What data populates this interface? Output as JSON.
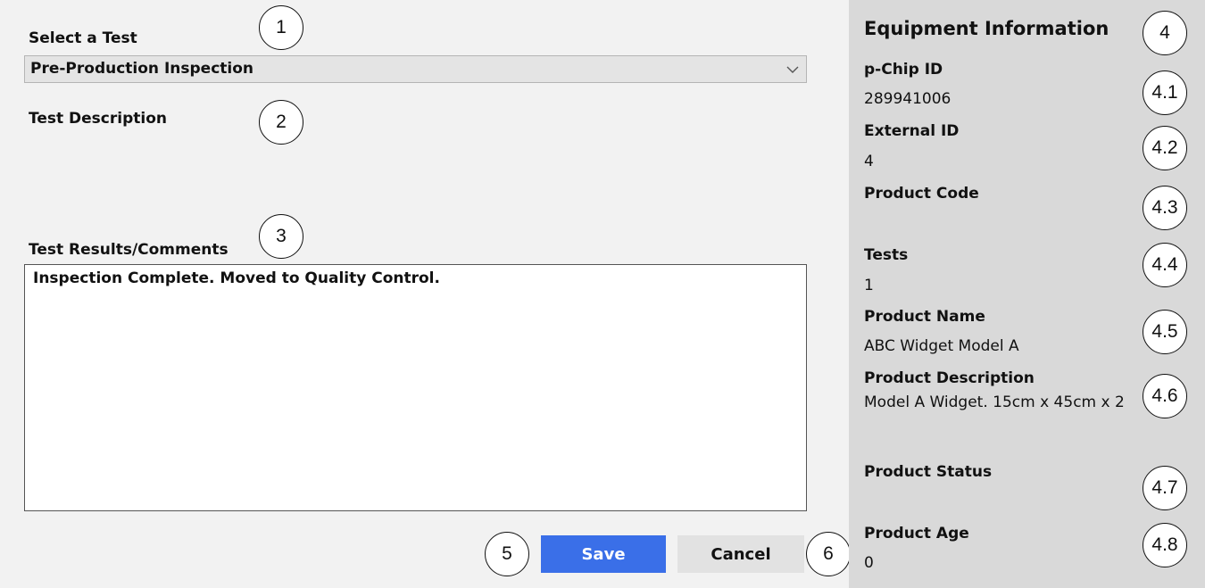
{
  "form": {
    "select_test_label": "Select a Test",
    "selected_test": "Pre-Production Inspection",
    "test_description_label": "Test Description",
    "test_results_label": "Test Results/Comments",
    "test_results_value": "Inspection Complete. Moved to Quality Control.",
    "save_label": "Save",
    "cancel_label": "Cancel"
  },
  "equipment": {
    "title": "Equipment Information",
    "fields": [
      {
        "label": "p-Chip ID",
        "value": "289941006"
      },
      {
        "label": "External ID",
        "value": "4"
      },
      {
        "label": "Product Code",
        "value": ""
      },
      {
        "label": "Tests",
        "value": "1"
      },
      {
        "label": "Product Name",
        "value": "ABC Widget Model A"
      },
      {
        "label": "Product Description",
        "value": "Model A Widget. 15cm x 45cm x 2"
      },
      {
        "label": "Product Status",
        "value": ""
      },
      {
        "label": "Product Age",
        "value": "0"
      }
    ]
  },
  "callouts": {
    "c1": "1",
    "c2": "2",
    "c3": "3",
    "c4": "4",
    "c4_1": "4.1",
    "c4_2": "4.2",
    "c4_3": "4.3",
    "c4_4": "4.4",
    "c4_5": "4.5",
    "c4_6": "4.6",
    "c4_7": "4.7",
    "c4_8": "4.8",
    "c5": "5",
    "c6": "6"
  },
  "colors": {
    "page_background": "#f2f2f2",
    "panel_background": "#d9d9d9",
    "save_button": "#3a6fe8",
    "cancel_button": "#e2e2e2"
  },
  "icons": {
    "dropdown": "chevron-down-icon"
  }
}
